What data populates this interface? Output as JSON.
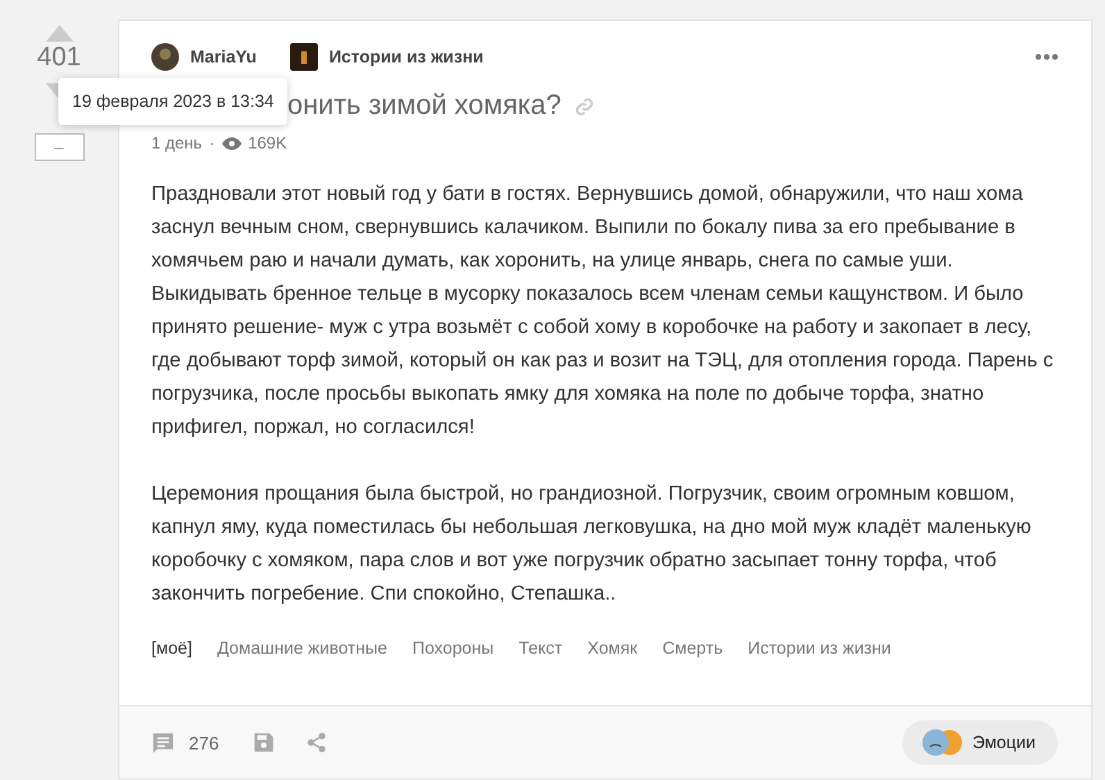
{
  "vote": {
    "count": "401",
    "collapse": "–"
  },
  "tooltip": {
    "text": "19 февраля 2023 в 13:34"
  },
  "post": {
    "author": "MariaYu",
    "community": "Истории из жизни",
    "title": "онить зимой хомяка?",
    "age": "1 день",
    "separator": "·",
    "views": "169K",
    "paragraphs": [
      "Праздновали этот новый год у бати в гостях. Вернувшись домой, обнаружили, что наш хома заснул вечным сном, свернувшись калачиком. Выпили по бокалу пива за его пребывание в хомячьем раю и начали думать, как хоронить, на улице январь, снега по самые уши. Выкидывать бренное тельце в мусорку показалось всем членам семьи кащунством. И было принято решение- муж с утра возьмёт с собой хому в коробочке на работу и закопает в лесу, где добывают торф зимой, который он как раз и возит на ТЭЦ, для отопления города. Парень с погрузчика, после просьбы выкопать ямку для хомяка на поле по добыче торфа, знатно прифигел, поржал, но согласился!",
      "Церемония прощания была быстрой, но грандиозной. Погрузчик, своим огромным ковшом, капнул яму, куда поместилась бы небольшая легковушка, на дно мой муж кладёт маленькую коробочку с хомяком, пара слов и вот уже погрузчик обратно засыпает тонну торфа, чтоб закончить погребение. Спи спокойно, Степашка.."
    ],
    "tags": [
      {
        "label": "[моё]",
        "kind": "mine"
      },
      {
        "label": "Домашние животные",
        "kind": "tag"
      },
      {
        "label": "Похороны",
        "kind": "tag"
      },
      {
        "label": "Текст",
        "kind": "tag"
      },
      {
        "label": "Хомяк",
        "kind": "tag"
      },
      {
        "label": "Смерть",
        "kind": "tag"
      },
      {
        "label": "Истории из жизни",
        "kind": "tag"
      }
    ],
    "comments": "276",
    "emotions": "Эмоции"
  }
}
